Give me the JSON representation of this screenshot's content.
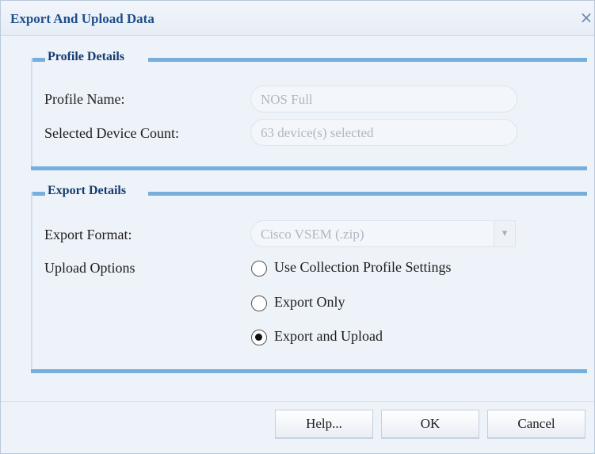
{
  "dialog": {
    "title": "Export And Upload Data",
    "close_glyph": "×"
  },
  "profile_details": {
    "legend": "Profile Details",
    "profile_name_label": "Profile Name:",
    "profile_name_value": "NOS Full",
    "device_count_label": "Selected Device Count:",
    "device_count_value": "63 device(s) selected"
  },
  "export_details": {
    "legend": "Export Details",
    "export_format_label": "Export Format:",
    "export_format_value": "Cisco VSEM (.zip)",
    "export_format_arrow": "▾",
    "upload_options_label": "Upload Options",
    "upload_options": [
      {
        "label": "Use Collection Profile Settings",
        "checked": false
      },
      {
        "label": "Export Only",
        "checked": false
      },
      {
        "label": "Export and Upload",
        "checked": true
      }
    ]
  },
  "buttons": {
    "help": "Help...",
    "ok": "OK",
    "cancel": "Cancel"
  },
  "colors": {
    "title_text": "#1f4e8c",
    "group_bar": "#76aedd",
    "dialog_bg": "#eef3f9"
  }
}
